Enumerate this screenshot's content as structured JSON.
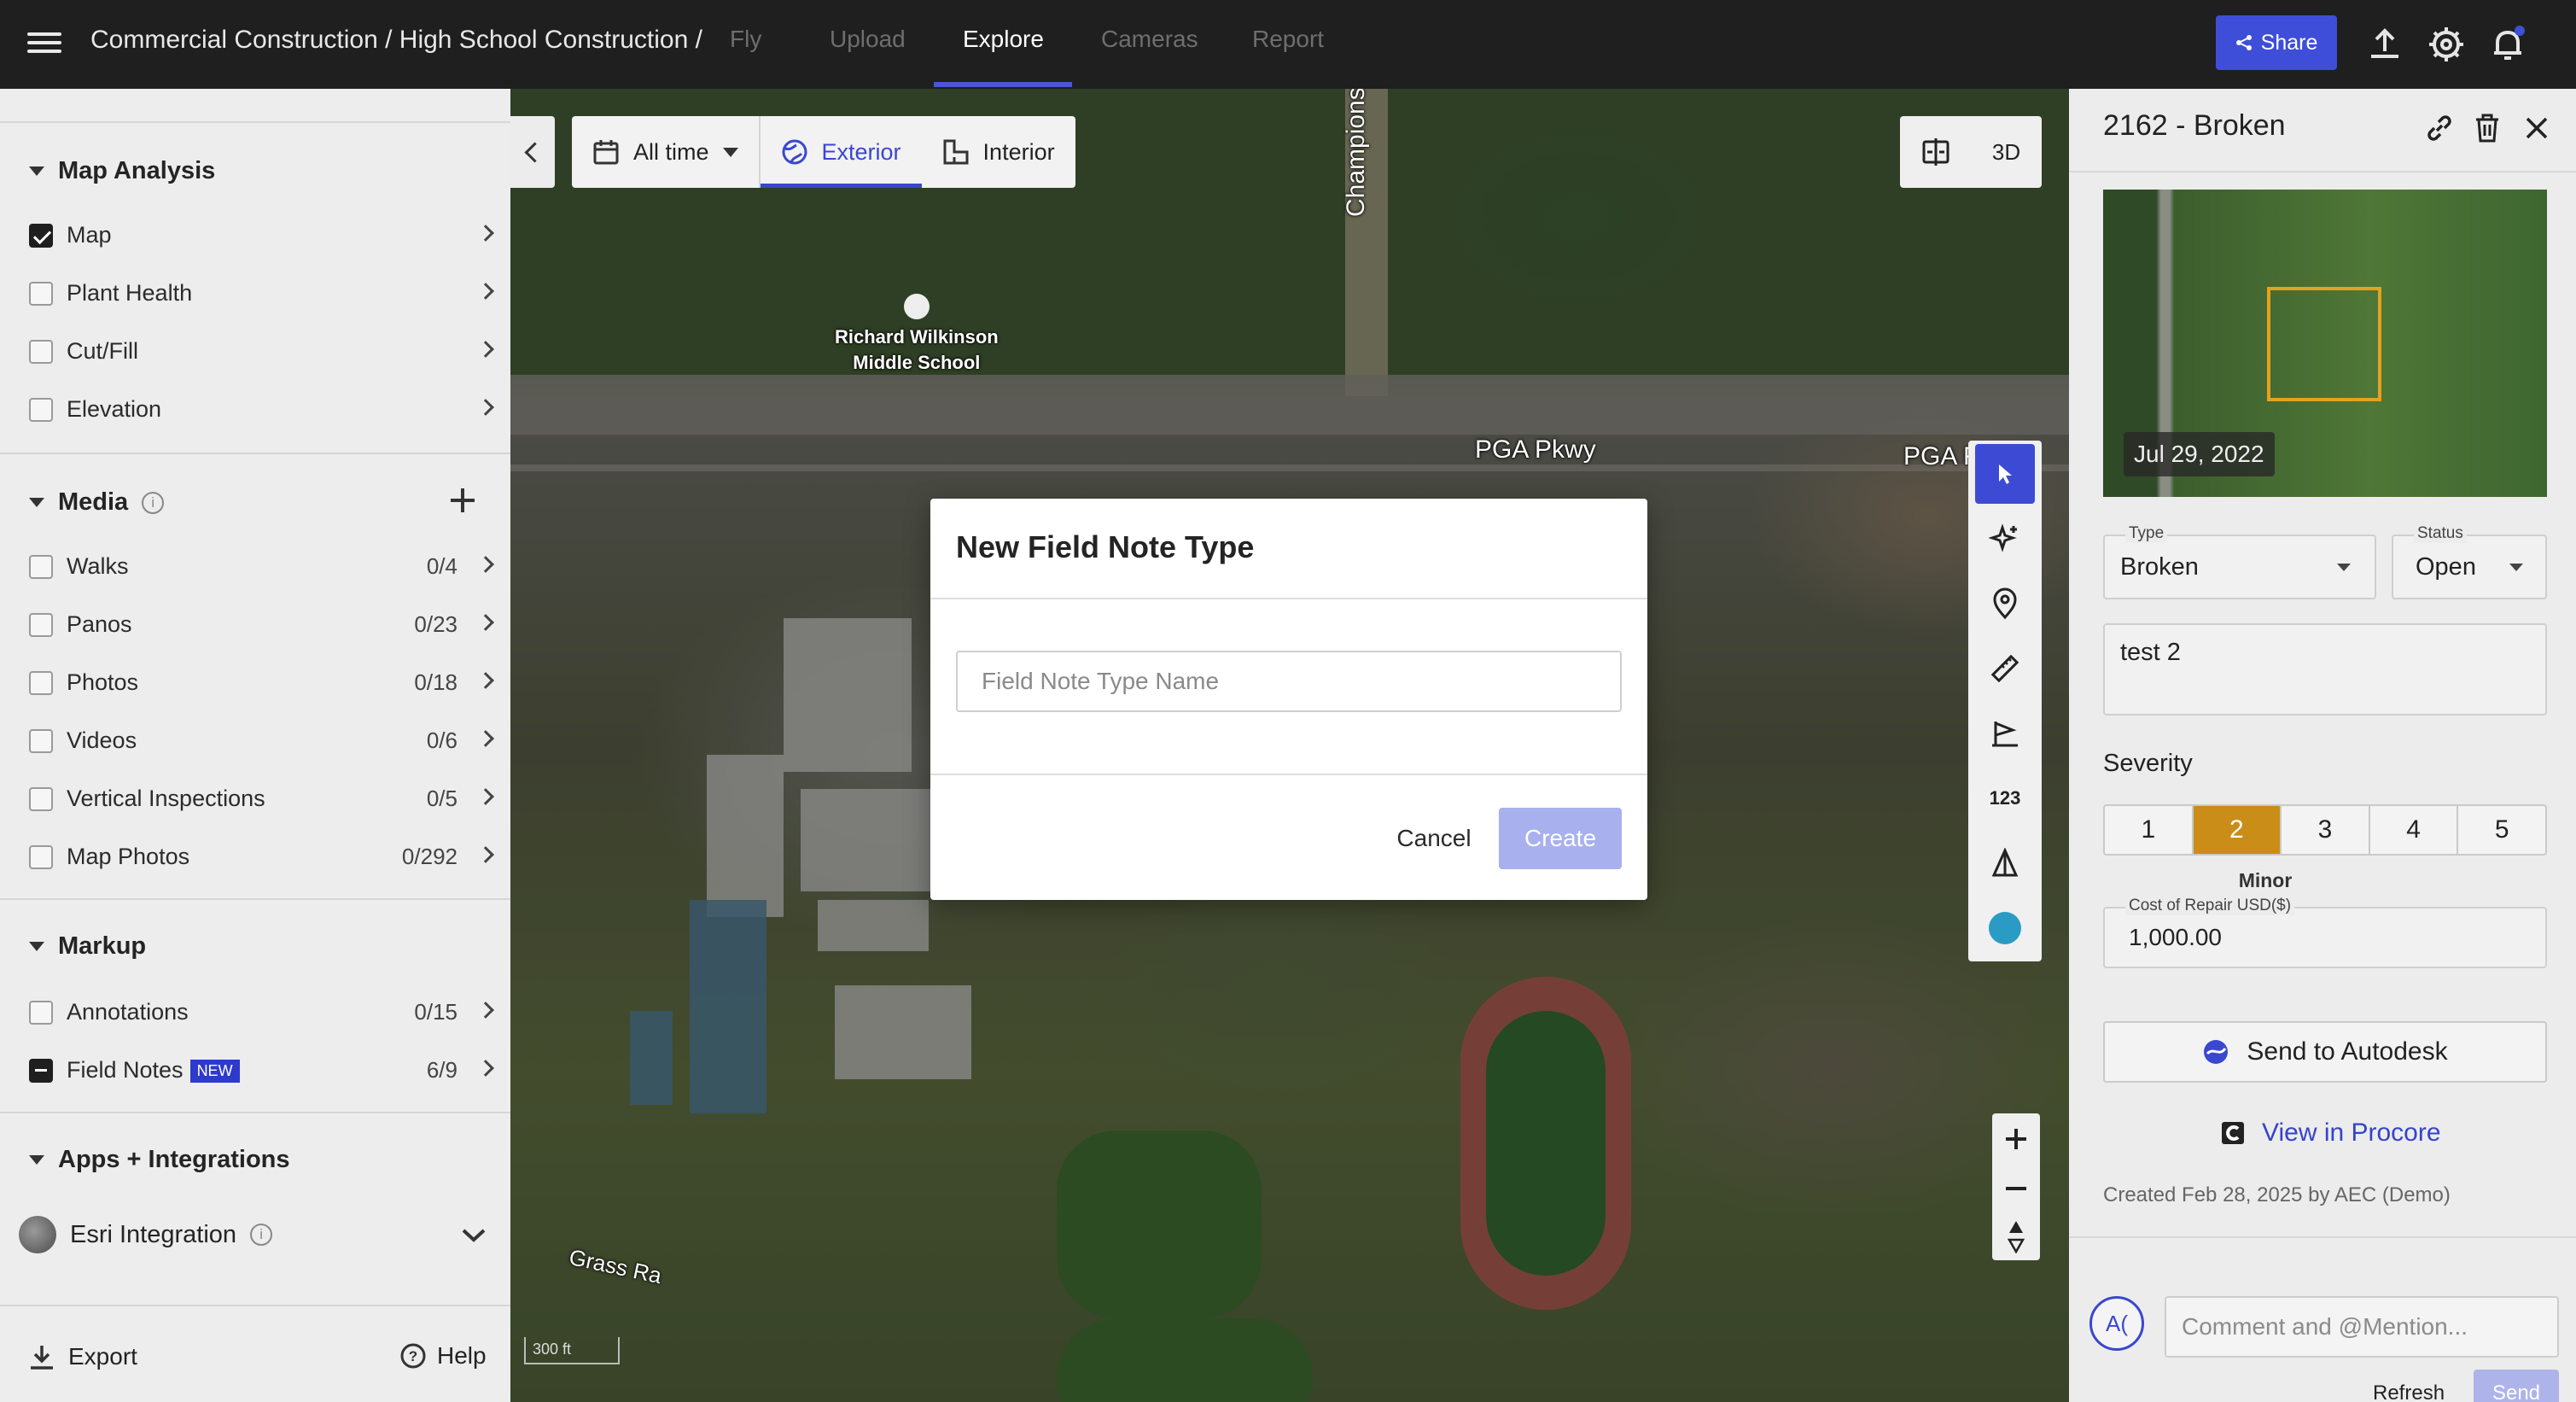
{
  "topbar": {
    "breadcrumb": "Commercial Construction / High School Construction /",
    "tabs": [
      "Fly",
      "Upload",
      "Explore",
      "Cameras",
      "Report"
    ],
    "active_tab": "Explore",
    "share_label": "Share"
  },
  "sidebar": {
    "map_analysis": {
      "title": "Map Analysis",
      "items": [
        {
          "label": "Map",
          "checked": true
        },
        {
          "label": "Plant Health",
          "checked": false
        },
        {
          "label": "Cut/Fill",
          "checked": false
        },
        {
          "label": "Elevation",
          "checked": false
        }
      ]
    },
    "media": {
      "title": "Media",
      "items": [
        {
          "label": "Walks",
          "count": "0/4"
        },
        {
          "label": "Panos",
          "count": "0/23"
        },
        {
          "label": "Photos",
          "count": "0/18"
        },
        {
          "label": "Videos",
          "count": "0/6"
        },
        {
          "label": "Vertical Inspections",
          "count": "0/5"
        },
        {
          "label": "Map Photos",
          "count": "0/292"
        }
      ]
    },
    "markup": {
      "title": "Markup",
      "items": [
        {
          "label": "Annotations",
          "count": "0/15"
        },
        {
          "label": "Field Notes",
          "count": "6/9",
          "badge": "NEW"
        }
      ]
    },
    "apps": {
      "title": "Apps + Integrations",
      "esri_label": "Esri Integration"
    },
    "export_label": "Export",
    "help_label": "Help"
  },
  "map": {
    "time_filter": "All time",
    "tabs": [
      "Exterior",
      "Interior"
    ],
    "active_tab": "Exterior",
    "view_3d": "3D",
    "labels": {
      "school": "Richard Wilkinson\nMiddle School",
      "road_vertical": "Championship",
      "road_pga_1": "PGA Pkwy",
      "road_pga_2": "PGA F",
      "road_grass": "Grass Ra",
      "scale": "300 ft"
    },
    "measure_tool": "123"
  },
  "dialog": {
    "title": "New Field Note Type",
    "input_placeholder": "Field Note Type Name",
    "cancel_label": "Cancel",
    "create_label": "Create"
  },
  "right_panel": {
    "title": "2162 - Broken",
    "thumbnail_date": "Jul 29, 2022",
    "type_label": "Type",
    "type_value": "Broken",
    "status_label": "Status",
    "status_value": "Open",
    "note_text": "test 2",
    "severity_label": "Severity",
    "severity_options": [
      "1",
      "2",
      "3",
      "4",
      "5"
    ],
    "severity_selected": "2",
    "severity_caption": "Minor",
    "cost_label": "Cost of Repair USD($)",
    "cost_value": "1,000.00",
    "autodesk_label": "Send to Autodesk",
    "procore_label": "View in Procore",
    "created_text": "Created Feb 28, 2025 by AEC (Demo)",
    "avatar_initials": "A(",
    "comment_placeholder": "Comment and @Mention...",
    "refresh_label": "Refresh",
    "send_label": "Send"
  },
  "colors": {
    "accent": "#3a47cf",
    "severity_active": "#c98d18",
    "topbar_bg": "#1f1f1f"
  }
}
